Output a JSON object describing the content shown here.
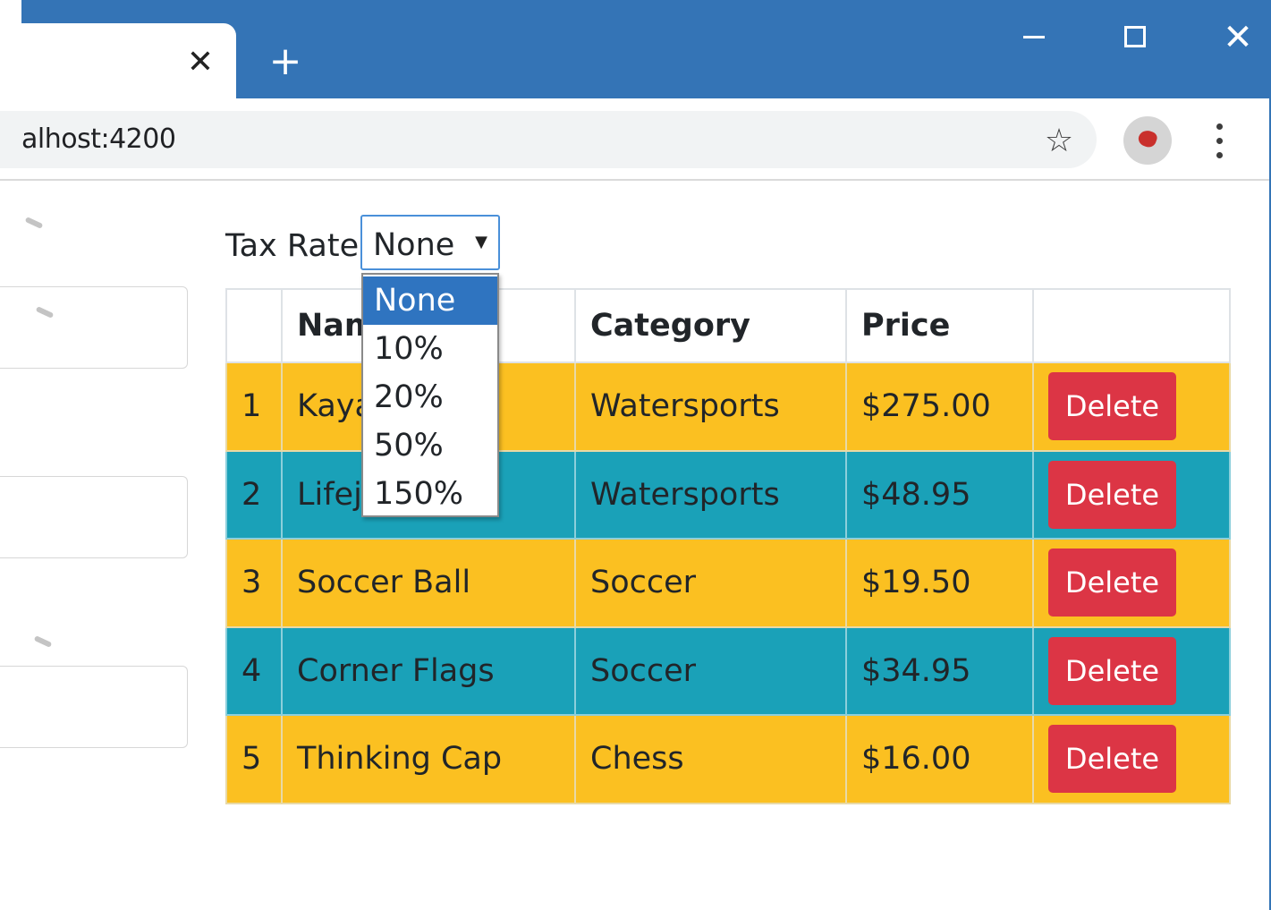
{
  "browser": {
    "tab_close_glyph": "✕",
    "new_tab_glyph": "+",
    "window_close_glyph": "✕",
    "url": "alhost:4200",
    "star_icon": "star-icon",
    "profile_icon": "avatar-icon",
    "menu_icon": "more-vert-icon",
    "accent_color": "#3474b6"
  },
  "tax": {
    "label": "Tax Rate:",
    "selected": "None",
    "options": [
      "None",
      "10%",
      "20%",
      "50%",
      "150%"
    ]
  },
  "table": {
    "headers": [
      "",
      "Name",
      "Category",
      "Price",
      ""
    ],
    "rows": [
      {
        "id": "1",
        "name": "Kaya",
        "category": "Watersports",
        "price": "$275.00",
        "action": "Delete",
        "style": "warning"
      },
      {
        "id": "2",
        "name": "Lifeja",
        "category": "Watersports",
        "price": "$48.95",
        "action": "Delete",
        "style": "info"
      },
      {
        "id": "3",
        "name": "Soccer Ball",
        "category": "Soccer",
        "price": "$19.50",
        "action": "Delete",
        "style": "warning"
      },
      {
        "id": "4",
        "name": "Corner Flags",
        "category": "Soccer",
        "price": "$34.95",
        "action": "Delete",
        "style": "info"
      },
      {
        "id": "5",
        "name": "Thinking Cap",
        "category": "Chess",
        "price": "$16.00",
        "action": "Delete",
        "style": "warning"
      }
    ],
    "colors": {
      "warning": "#fbc021",
      "info": "#1aa1b8",
      "danger": "#dc3545"
    }
  }
}
